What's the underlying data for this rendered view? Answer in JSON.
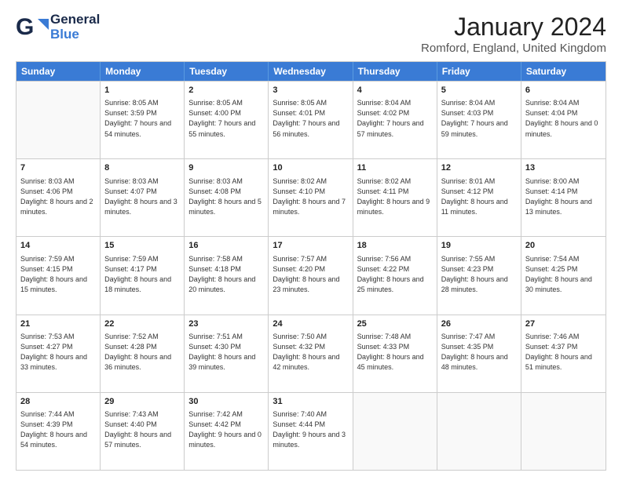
{
  "logo": {
    "line1": "General",
    "line2": "Blue"
  },
  "title": "January 2024",
  "subtitle": "Romford, England, United Kingdom",
  "header_days": [
    "Sunday",
    "Monday",
    "Tuesday",
    "Wednesday",
    "Thursday",
    "Friday",
    "Saturday"
  ],
  "weeks": [
    [
      {
        "day": "",
        "sunrise": "",
        "sunset": "",
        "daylight": ""
      },
      {
        "day": "1",
        "sunrise": "Sunrise: 8:05 AM",
        "sunset": "Sunset: 3:59 PM",
        "daylight": "Daylight: 7 hours and 54 minutes."
      },
      {
        "day": "2",
        "sunrise": "Sunrise: 8:05 AM",
        "sunset": "Sunset: 4:00 PM",
        "daylight": "Daylight: 7 hours and 55 minutes."
      },
      {
        "day": "3",
        "sunrise": "Sunrise: 8:05 AM",
        "sunset": "Sunset: 4:01 PM",
        "daylight": "Daylight: 7 hours and 56 minutes."
      },
      {
        "day": "4",
        "sunrise": "Sunrise: 8:04 AM",
        "sunset": "Sunset: 4:02 PM",
        "daylight": "Daylight: 7 hours and 57 minutes."
      },
      {
        "day": "5",
        "sunrise": "Sunrise: 8:04 AM",
        "sunset": "Sunset: 4:03 PM",
        "daylight": "Daylight: 7 hours and 59 minutes."
      },
      {
        "day": "6",
        "sunrise": "Sunrise: 8:04 AM",
        "sunset": "Sunset: 4:04 PM",
        "daylight": "Daylight: 8 hours and 0 minutes."
      }
    ],
    [
      {
        "day": "7",
        "sunrise": "Sunrise: 8:03 AM",
        "sunset": "Sunset: 4:06 PM",
        "daylight": "Daylight: 8 hours and 2 minutes."
      },
      {
        "day": "8",
        "sunrise": "Sunrise: 8:03 AM",
        "sunset": "Sunset: 4:07 PM",
        "daylight": "Daylight: 8 hours and 3 minutes."
      },
      {
        "day": "9",
        "sunrise": "Sunrise: 8:03 AM",
        "sunset": "Sunset: 4:08 PM",
        "daylight": "Daylight: 8 hours and 5 minutes."
      },
      {
        "day": "10",
        "sunrise": "Sunrise: 8:02 AM",
        "sunset": "Sunset: 4:10 PM",
        "daylight": "Daylight: 8 hours and 7 minutes."
      },
      {
        "day": "11",
        "sunrise": "Sunrise: 8:02 AM",
        "sunset": "Sunset: 4:11 PM",
        "daylight": "Daylight: 8 hours and 9 minutes."
      },
      {
        "day": "12",
        "sunrise": "Sunrise: 8:01 AM",
        "sunset": "Sunset: 4:12 PM",
        "daylight": "Daylight: 8 hours and 11 minutes."
      },
      {
        "day": "13",
        "sunrise": "Sunrise: 8:00 AM",
        "sunset": "Sunset: 4:14 PM",
        "daylight": "Daylight: 8 hours and 13 minutes."
      }
    ],
    [
      {
        "day": "14",
        "sunrise": "Sunrise: 7:59 AM",
        "sunset": "Sunset: 4:15 PM",
        "daylight": "Daylight: 8 hours and 15 minutes."
      },
      {
        "day": "15",
        "sunrise": "Sunrise: 7:59 AM",
        "sunset": "Sunset: 4:17 PM",
        "daylight": "Daylight: 8 hours and 18 minutes."
      },
      {
        "day": "16",
        "sunrise": "Sunrise: 7:58 AM",
        "sunset": "Sunset: 4:18 PM",
        "daylight": "Daylight: 8 hours and 20 minutes."
      },
      {
        "day": "17",
        "sunrise": "Sunrise: 7:57 AM",
        "sunset": "Sunset: 4:20 PM",
        "daylight": "Daylight: 8 hours and 23 minutes."
      },
      {
        "day": "18",
        "sunrise": "Sunrise: 7:56 AM",
        "sunset": "Sunset: 4:22 PM",
        "daylight": "Daylight: 8 hours and 25 minutes."
      },
      {
        "day": "19",
        "sunrise": "Sunrise: 7:55 AM",
        "sunset": "Sunset: 4:23 PM",
        "daylight": "Daylight: 8 hours and 28 minutes."
      },
      {
        "day": "20",
        "sunrise": "Sunrise: 7:54 AM",
        "sunset": "Sunset: 4:25 PM",
        "daylight": "Daylight: 8 hours and 30 minutes."
      }
    ],
    [
      {
        "day": "21",
        "sunrise": "Sunrise: 7:53 AM",
        "sunset": "Sunset: 4:27 PM",
        "daylight": "Daylight: 8 hours and 33 minutes."
      },
      {
        "day": "22",
        "sunrise": "Sunrise: 7:52 AM",
        "sunset": "Sunset: 4:28 PM",
        "daylight": "Daylight: 8 hours and 36 minutes."
      },
      {
        "day": "23",
        "sunrise": "Sunrise: 7:51 AM",
        "sunset": "Sunset: 4:30 PM",
        "daylight": "Daylight: 8 hours and 39 minutes."
      },
      {
        "day": "24",
        "sunrise": "Sunrise: 7:50 AM",
        "sunset": "Sunset: 4:32 PM",
        "daylight": "Daylight: 8 hours and 42 minutes."
      },
      {
        "day": "25",
        "sunrise": "Sunrise: 7:48 AM",
        "sunset": "Sunset: 4:33 PM",
        "daylight": "Daylight: 8 hours and 45 minutes."
      },
      {
        "day": "26",
        "sunrise": "Sunrise: 7:47 AM",
        "sunset": "Sunset: 4:35 PM",
        "daylight": "Daylight: 8 hours and 48 minutes."
      },
      {
        "day": "27",
        "sunrise": "Sunrise: 7:46 AM",
        "sunset": "Sunset: 4:37 PM",
        "daylight": "Daylight: 8 hours and 51 minutes."
      }
    ],
    [
      {
        "day": "28",
        "sunrise": "Sunrise: 7:44 AM",
        "sunset": "Sunset: 4:39 PM",
        "daylight": "Daylight: 8 hours and 54 minutes."
      },
      {
        "day": "29",
        "sunrise": "Sunrise: 7:43 AM",
        "sunset": "Sunset: 4:40 PM",
        "daylight": "Daylight: 8 hours and 57 minutes."
      },
      {
        "day": "30",
        "sunrise": "Sunrise: 7:42 AM",
        "sunset": "Sunset: 4:42 PM",
        "daylight": "Daylight: 9 hours and 0 minutes."
      },
      {
        "day": "31",
        "sunrise": "Sunrise: 7:40 AM",
        "sunset": "Sunset: 4:44 PM",
        "daylight": "Daylight: 9 hours and 3 minutes."
      },
      {
        "day": "",
        "sunrise": "",
        "sunset": "",
        "daylight": ""
      },
      {
        "day": "",
        "sunrise": "",
        "sunset": "",
        "daylight": ""
      },
      {
        "day": "",
        "sunrise": "",
        "sunset": "",
        "daylight": ""
      }
    ]
  ]
}
